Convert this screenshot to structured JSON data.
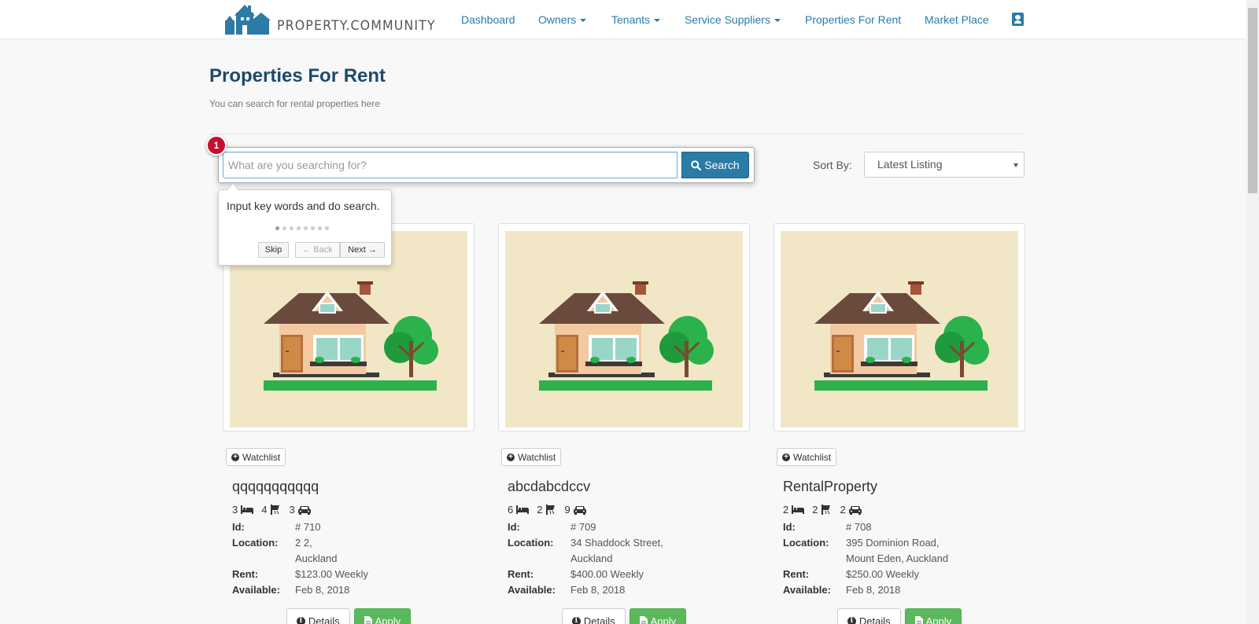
{
  "brand": {
    "name": "PROPERTY.COMMUNITY",
    "color": "#2a7ba5"
  },
  "nav": {
    "items": [
      {
        "label": "Dashboard",
        "dropdown": false
      },
      {
        "label": "Owners",
        "dropdown": true
      },
      {
        "label": "Tenants",
        "dropdown": true
      },
      {
        "label": "Service Suppliers",
        "dropdown": true
      },
      {
        "label": "Properties For Rent",
        "dropdown": false
      },
      {
        "label": "Market Place",
        "dropdown": false
      }
    ],
    "user_icon": "user-card-icon"
  },
  "page": {
    "title": "Properties For Rent",
    "subtitle": "You can search for rental properties here"
  },
  "search": {
    "placeholder": "What are you searching for?",
    "button_label": "Search",
    "value": ""
  },
  "sort": {
    "label": "Sort By:",
    "selected": "Latest Listing"
  },
  "tour": {
    "step_number": "1",
    "text": "Input key words and do search.",
    "total_steps": 8,
    "current_step": 1,
    "skip_label": "Skip",
    "back_label": "← Back",
    "next_label": "Next →"
  },
  "labels": {
    "watchlist": "Watchlist",
    "id": "Id:",
    "location": "Location:",
    "rent": "Rent:",
    "available": "Available:",
    "details": "Details",
    "apply": "Apply"
  },
  "listings": [
    {
      "title": "qqqqqqqqqqq",
      "beds": "3",
      "baths": "4",
      "parking": "3",
      "id": "# 710",
      "location_line1": "2 2,",
      "location_line2": "Auckland",
      "rent": "$123.00 Weekly",
      "available": "Feb 8, 2018"
    },
    {
      "title": "abcdabcdccv",
      "beds": "6",
      "baths": "2",
      "parking": "9",
      "id": "# 709",
      "location_line1": "34 Shaddock Street,",
      "location_line2": "Auckland",
      "rent": "$400.00 Weekly",
      "available": "Feb 8, 2018"
    },
    {
      "title": "RentalProperty",
      "beds": "2",
      "baths": "2",
      "parking": "2",
      "id": "# 708",
      "location_line1": "395 Dominion Road,",
      "location_line2": "Mount Eden, Auckland",
      "rent": "$250.00 Weekly",
      "available": "Feb 8, 2018"
    }
  ]
}
